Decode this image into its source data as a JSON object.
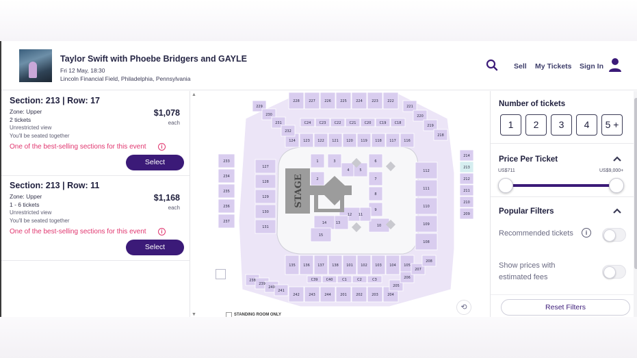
{
  "header": {
    "event_title": "Taylor Swift with Phoebe Bridgers and GAYLE",
    "event_date": "Fri 12 May, 18:30",
    "event_venue": "Lincoln Financial Field, Philadelphia, Pennsylvania",
    "nav": {
      "sell": "Sell",
      "my_tickets": "My Tickets",
      "sign_in": "Sign In"
    },
    "icons": {
      "search": "search-icon",
      "avatar": "user-icon"
    }
  },
  "listings": [
    {
      "title": "Section: 213 | Row: 17",
      "zone": "Zone: Upper",
      "quantity": "2 tickets",
      "view": "Unrestricted view",
      "seating": "You'll be seated together",
      "price": "$1,078",
      "price_unit": "each",
      "badge": "One of the best-selling sections for this event",
      "select_label": "Select"
    },
    {
      "title": "Section: 213 | Row: 11",
      "zone": "Zone: Upper",
      "quantity": "1 - 6 tickets",
      "view": "Unrestricted view",
      "seating": "You'll be seated together",
      "price": "$1,168",
      "price_unit": "each",
      "badge": "One of the best-selling sections for this event",
      "select_label": "Select"
    }
  ],
  "map": {
    "stage_label": "STAGE",
    "standing_room": "STANDING ROOM ONLY",
    "zoom_in": "+",
    "zoom_out": "−",
    "colors": {
      "section": "#d9cdef",
      "section_stroke": "#ffffff",
      "highlight": "#d6eef0",
      "field": "#f4f4f6",
      "stage": "#9a9a9a"
    }
  },
  "filters": {
    "num_tickets_heading": "Number of tickets",
    "quantity_options": [
      "1",
      "2",
      "3",
      "4",
      "5 +"
    ],
    "price_heading": "Price Per Ticket",
    "price_min_label": "US$711",
    "price_max_label": "US$9,000+",
    "popular_heading": "Popular Filters",
    "options": [
      {
        "label": "Recommended tickets",
        "enabled": false
      },
      {
        "label": "Show prices with estimated fees",
        "enabled": false
      }
    ],
    "reset_label": "Reset Filters"
  },
  "colors": {
    "accent": "#3b1a78",
    "badge": "#e0356e"
  }
}
